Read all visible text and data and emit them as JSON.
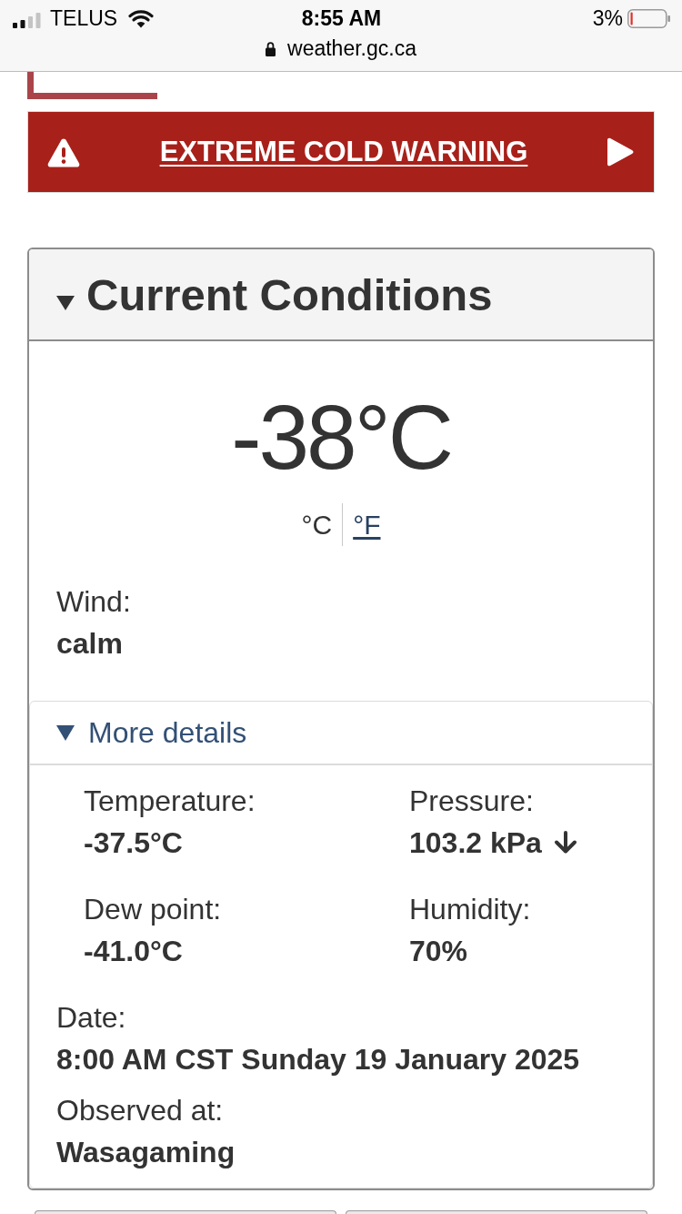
{
  "status_bar": {
    "carrier": "TELUS",
    "time": "8:55 AM",
    "battery": "3%",
    "url": "weather.gc.ca"
  },
  "alert": {
    "title": "EXTREME COLD WARNING"
  },
  "current_conditions": {
    "title": "Current Conditions",
    "expanded": true,
    "temperature": "-38°C",
    "units": [
      {
        "label": "°C",
        "selected": true
      },
      {
        "label": "°F",
        "selected": false
      }
    ],
    "wind": {
      "label": "Wind:",
      "value": "calm"
    },
    "more_details": {
      "title": "More details",
      "expanded": true,
      "items": [
        {
          "kind": "plain",
          "label": "Temperature:",
          "value": "-37.5°C"
        },
        {
          "kind": "falling",
          "label": "Pressure:",
          "value": "103.2 kPa"
        },
        {
          "kind": "plain",
          "label": "Dew point:",
          "value": "-41.0°C"
        },
        {
          "kind": "plain",
          "label": "Humidity:",
          "value": "70%"
        }
      ],
      "observation": [
        {
          "label": "Date:",
          "value": "8:00 AM CST Sunday 19 January 2025"
        },
        {
          "label": "Observed at:",
          "value": "Wasagaming"
        }
      ]
    }
  }
}
